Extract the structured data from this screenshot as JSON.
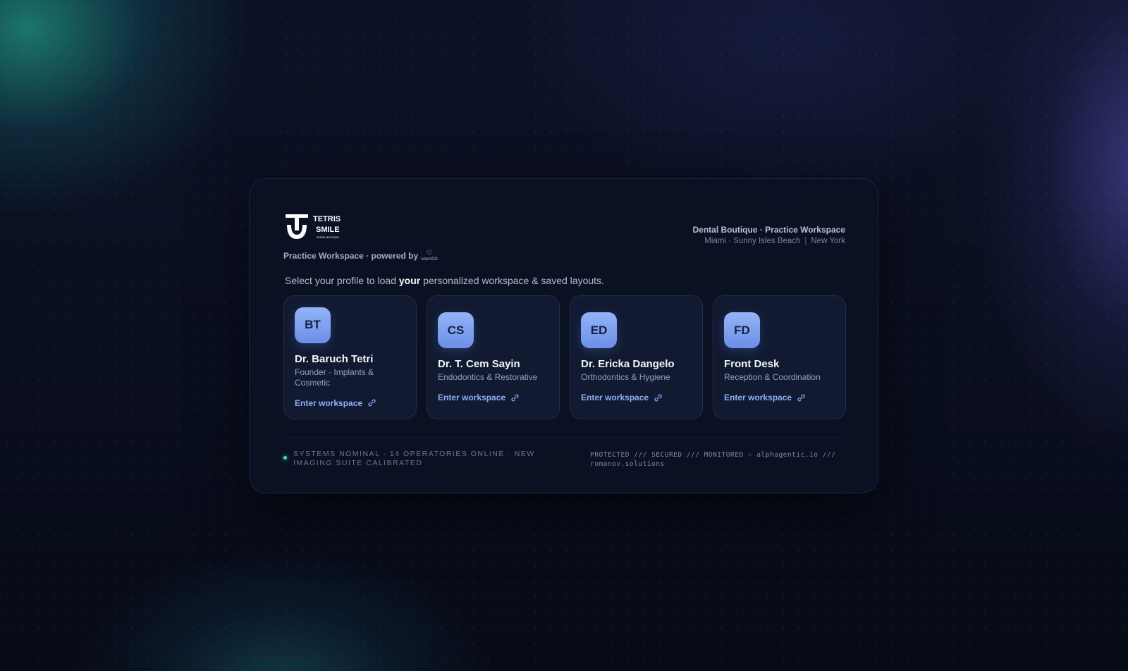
{
  "brand": {
    "logo_line1": "TETRIS",
    "logo_line2": "SMILE",
    "logo_tagline": "DENTAL BOUTIQUE",
    "powered_by": "Practice Workspace · powered by",
    "powered_logo": "odontOS"
  },
  "practice": {
    "title": "Dental Boutique · Practice Workspace",
    "location_primary": "Miami · Sunny Isles Beach",
    "location_secondary": "New York"
  },
  "prompt": {
    "before": "Select your profile to load",
    "emphasis": "your",
    "after": "personalized workspace & saved layouts."
  },
  "profiles": [
    {
      "initials": "BT",
      "name": "Dr. Baruch Tetri",
      "role": "Founder · Implants & Cosmetic",
      "action": "Enter workspace",
      "icon": "link-icon"
    },
    {
      "initials": "CS",
      "name": "Dr. T. Cem Sayin",
      "role": "Endodontics & Restorative",
      "action": "Enter workspace",
      "icon": "link-icon"
    },
    {
      "initials": "ED",
      "name": "Dr. Ericka Dangelo",
      "role": "Orthodontics & Hygiene",
      "action": "Enter workspace",
      "icon": "link-icon"
    },
    {
      "initials": "FD",
      "name": "Front Desk",
      "role": "Reception & Coordination",
      "action": "Enter workspace",
      "icon": "link-icon"
    }
  ],
  "footer": {
    "status": "SYSTEMS NOMINAL · 14 OPERATORIES ONLINE · NEW IMAGING SUITE CALIBRATED",
    "security": "PROTECTED /// SECURED /// MONITORED — alphagentic.io /// romanov.solutions"
  },
  "colors": {
    "accent": "#8ab0f5",
    "avatar_top": "#93b4f6",
    "avatar_bottom": "#6b8fe8",
    "status_ok": "#3fe2b0",
    "panel": "#0b1124",
    "card": "#111a31"
  }
}
